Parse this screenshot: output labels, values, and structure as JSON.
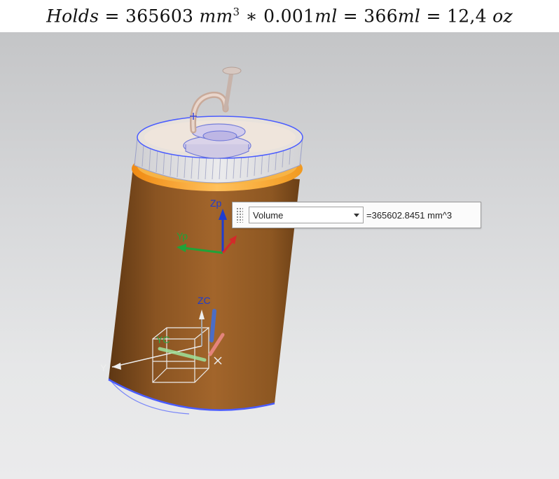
{
  "formula": {
    "lhs": "Holds",
    "eq1": "=",
    "volume": "365603",
    "volume_unit": "mm",
    "volume_unit_exp": "3",
    "times": "∗",
    "factor": "0.001",
    "factor_unit": "ml",
    "eq2": "=",
    "ml_value": "366",
    "ml_unit": "ml",
    "eq3": "=",
    "oz_value": "12,4",
    "oz_unit": "oz"
  },
  "measure": {
    "type_selected": "Volume",
    "result": "=365602.8451 mm^3"
  },
  "axes": {
    "part": {
      "z": "Zp",
      "y": "Yp"
    },
    "work": {
      "z": "ZC",
      "y": "YC",
      "y_far": "Y"
    }
  },
  "colors": {
    "body": "#9a5f25",
    "rim": "#f5a623",
    "lid": "#d9d9db",
    "edge_highlight": "#4a5cff",
    "axis_z": "#1e3ccf",
    "axis_y": "#1fa339",
    "axis_x": "#d42a2a"
  }
}
